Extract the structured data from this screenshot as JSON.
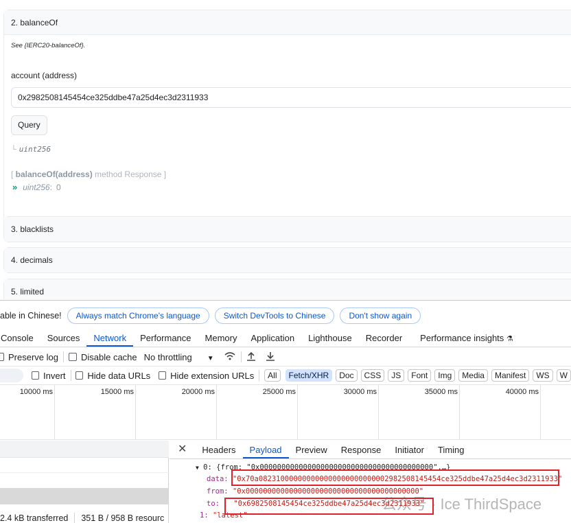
{
  "contract": {
    "balanceOf_title": "2. balanceOf",
    "see_note": "See {IERC20-balanceOf}.",
    "field_label": "account (address)",
    "address_value": "0x2982508145454ce325ddbe47a25d4ec3d2311933",
    "query_label": "Query",
    "return_type": "uint256",
    "response_open": "[ ",
    "response_method": "balanceOf(address)",
    "response_suffix": " method Response ]",
    "response_type": "uint256",
    "response_colon": " :",
    "response_value": "0",
    "collapsed": [
      "3. blacklists",
      "4. decimals",
      "5. limited"
    ]
  },
  "devtools": {
    "lang_text": "able in Chinese!",
    "lang_buttons": [
      "Always match Chrome's language",
      "Switch DevTools to Chinese",
      "Don't show again"
    ],
    "tabs": [
      "Console",
      "Sources",
      "Network",
      "Performance",
      "Memory",
      "Application",
      "Lighthouse",
      "Recorder",
      "Performance insights"
    ],
    "active_tab": "Network",
    "toolbar": {
      "preserve_log": "Preserve log",
      "disable_cache": "Disable cache",
      "throttling": "No throttling"
    },
    "filter": {
      "invert": "Invert",
      "hide_data_urls": "Hide data URLs",
      "hide_extension_urls": "Hide extension URLs",
      "chips": [
        "All",
        "Fetch/XHR",
        "Doc",
        "CSS",
        "JS",
        "Font",
        "Img",
        "Media",
        "Manifest",
        "WS",
        "W"
      ],
      "active_chip": "Fetch/XHR"
    },
    "timeline_ticks": [
      "10000 ms",
      "15000 ms",
      "20000 ms",
      "25000 ms",
      "30000 ms",
      "35000 ms",
      "40000 ms"
    ],
    "status": {
      "transferred": "2.4 kB transferred",
      "resources": "351 B / 958 B resourc"
    },
    "detail_tabs": [
      "Headers",
      "Payload",
      "Preview",
      "Response",
      "Initiator",
      "Timing"
    ],
    "active_detail_tab": "Payload",
    "payload": {
      "obj_label": "0: {from: \"0x0000000000000000000000000000000000000000\",…}",
      "data_key": "data:",
      "data_val": "\"0x70a082310000000000000000000000002982508145454ce325ddbe47a25d4ec3d2311933\"",
      "from_key": "from:",
      "from_val": "\"0x0000000000000000000000000000000000000000\"",
      "to_key": "to:",
      "to_val": "\"0x6982508145454ce325ddbe47a25d4ec3d2311933\"",
      "latest_key": "1:",
      "latest_val": "\"latest\""
    }
  },
  "watermark": "公众号 · Ice ThirdSpace",
  "colors": {
    "accent": "#0b57d0",
    "annotation_red": "#e0202a",
    "response_arrow": "#00a186"
  }
}
